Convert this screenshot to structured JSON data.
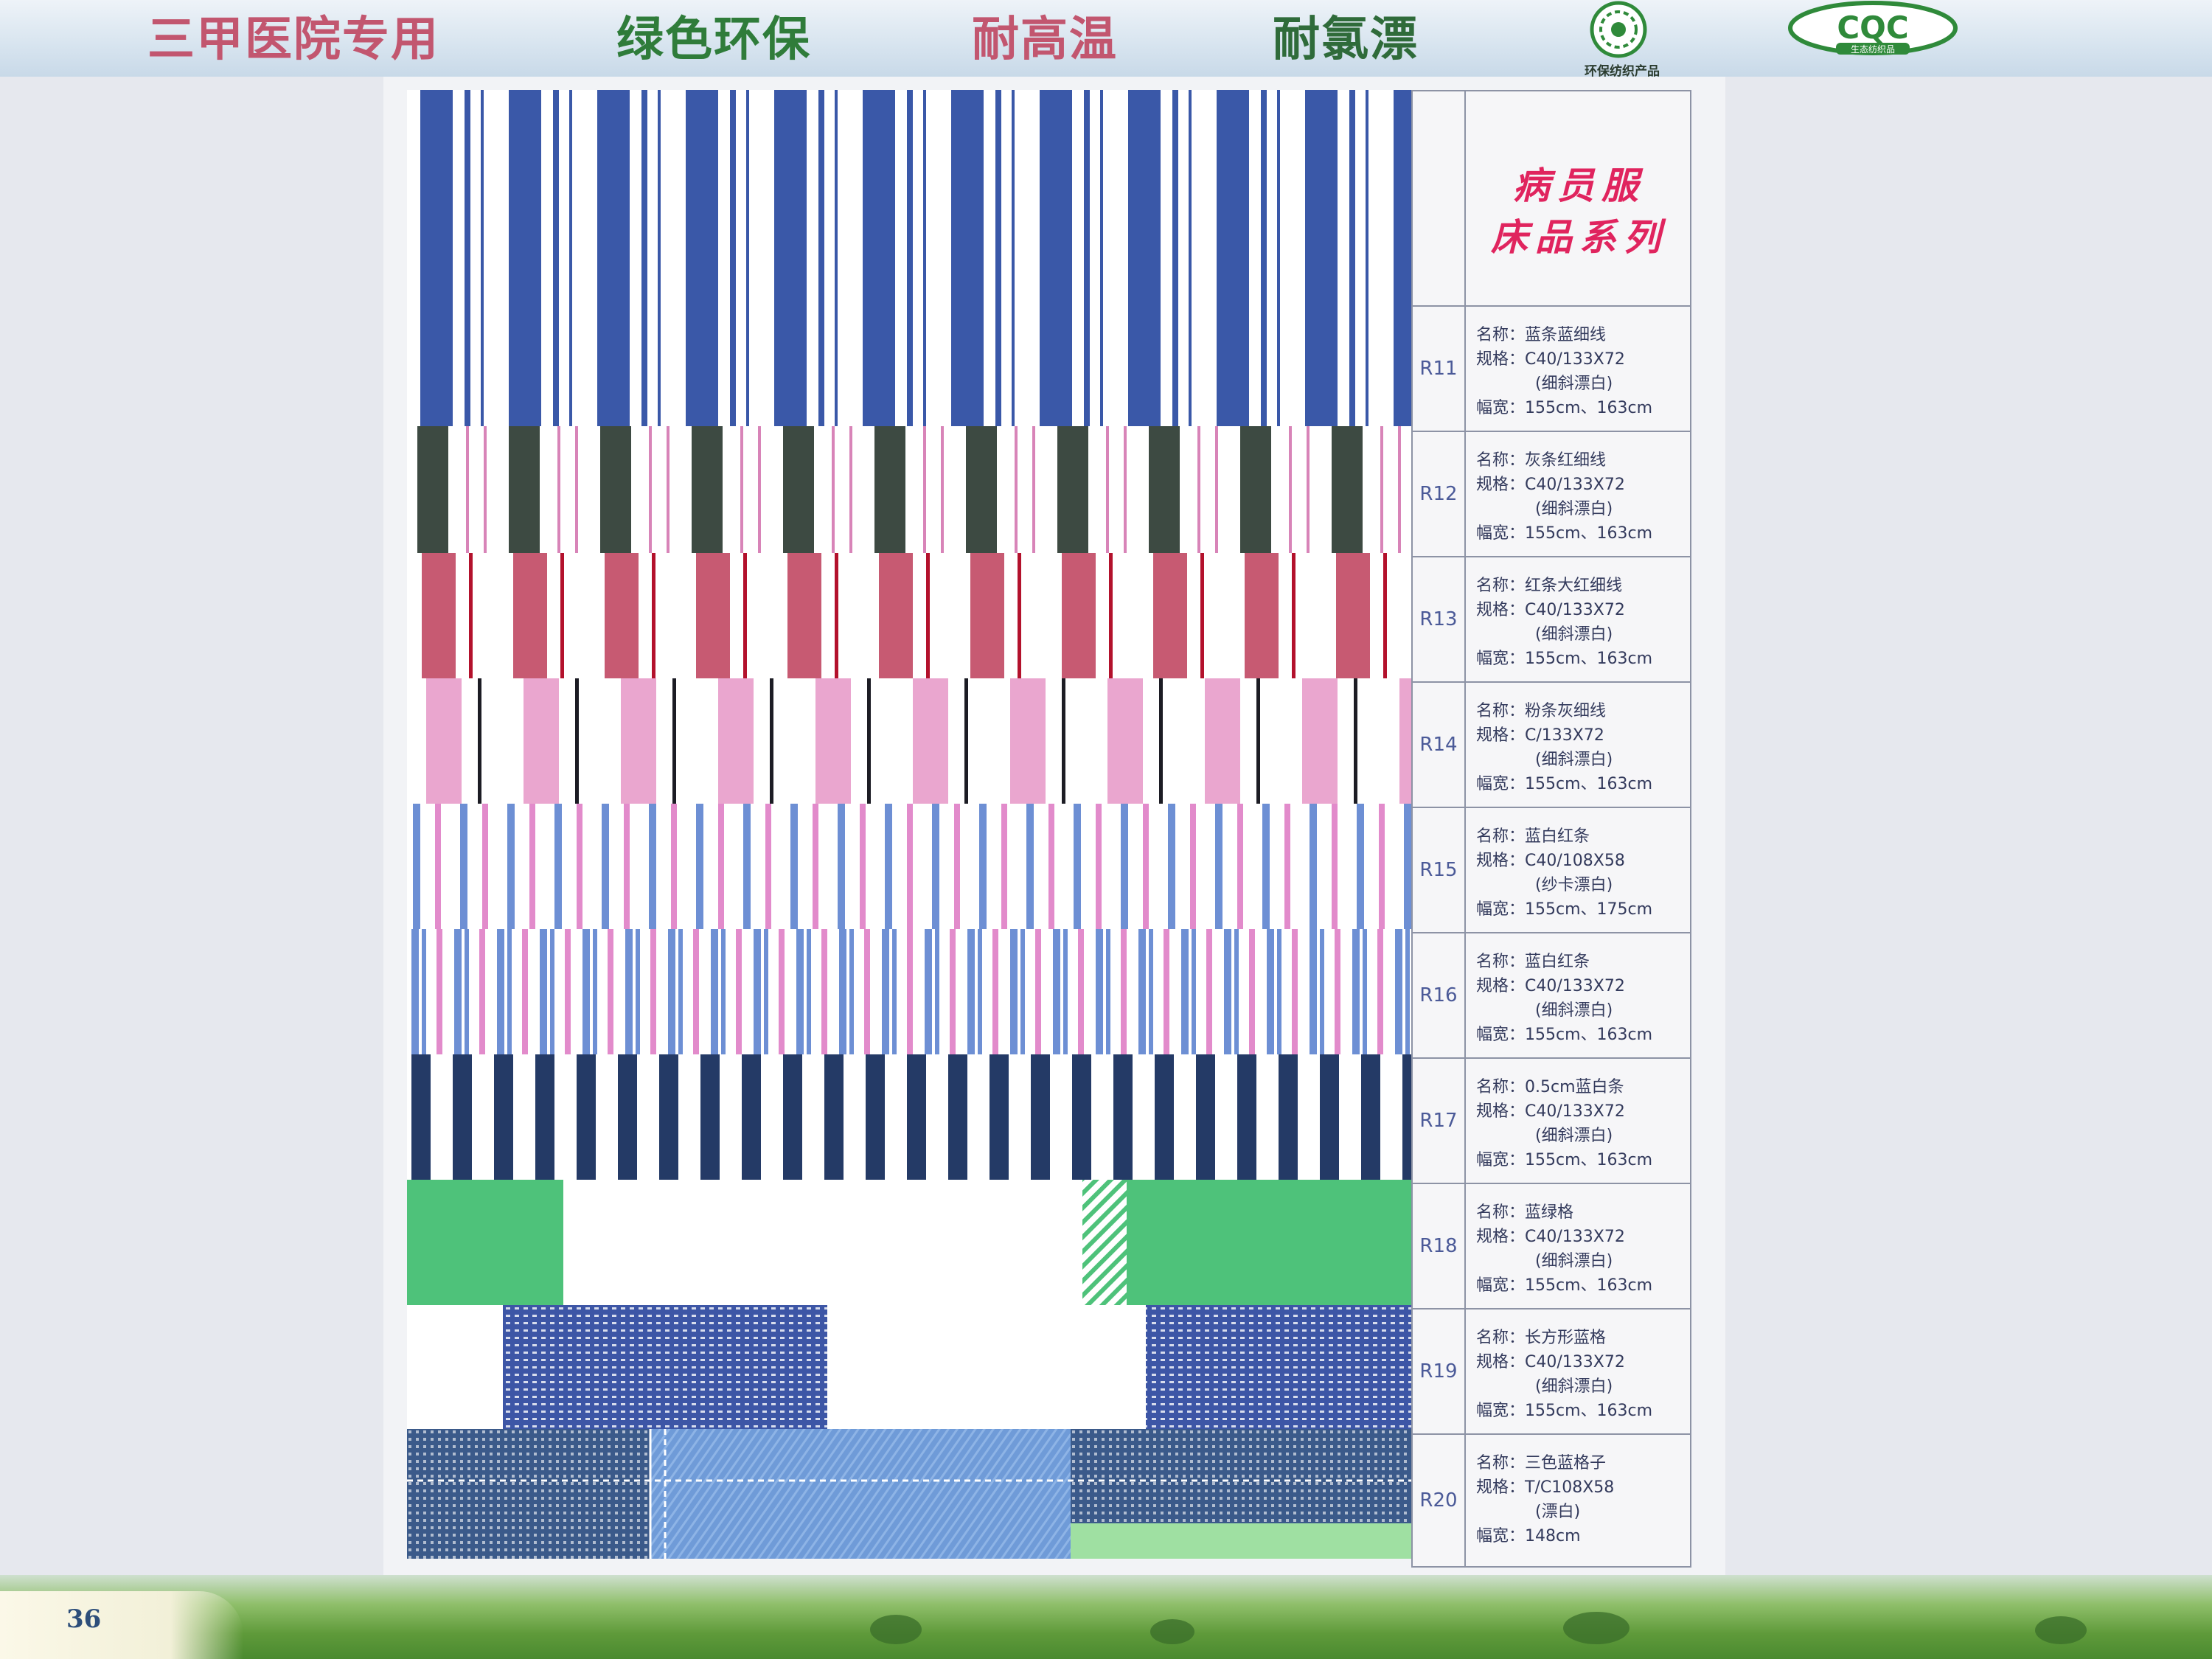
{
  "banner": {
    "slogans": [
      "三甲医院专用",
      "绿色环保",
      "耐高温",
      "耐氯漂"
    ],
    "eco_caption": "环保纺织产品",
    "cqc_text": "CQC",
    "cqc_caption": "生态纺织品"
  },
  "catalog": {
    "title_line1": "病员服",
    "title_line2": "床品系列"
  },
  "labels": {
    "name": "名称：",
    "spec": "规格：",
    "width": "幅宽："
  },
  "items": [
    {
      "code": "R11",
      "name": "蓝条蓝细线",
      "spec": "C40/133X72",
      "note": "(细斜漂白)",
      "width": "155cm、163cm"
    },
    {
      "code": "R12",
      "name": "灰条红细线",
      "spec": "C40/133X72",
      "note": "(细斜漂白)",
      "width": "155cm、163cm"
    },
    {
      "code": "R13",
      "name": "红条大红细线",
      "spec": "C40/133X72",
      "note": "(细斜漂白)",
      "width": "155cm、163cm"
    },
    {
      "code": "R14",
      "name": "粉条灰细线",
      "spec": "C/133X72",
      "note": "(细斜漂白)",
      "width": "155cm、163cm"
    },
    {
      "code": "R15",
      "name": "蓝白红条",
      "spec": "C40/108X58",
      "note": "(纱卡漂白)",
      "width": "155cm、175cm"
    },
    {
      "code": "R16",
      "name": "蓝白红条",
      "spec": "C40/133X72",
      "note": "(细斜漂白)",
      "width": "155cm、163cm"
    },
    {
      "code": "R17",
      "name": "0.5cm蓝白条",
      "spec": "C40/133X72",
      "note": "(细斜漂白)",
      "width": "155cm、163cm"
    },
    {
      "code": "R18",
      "name": "蓝绿格",
      "spec": "C40/133X72",
      "note": "(细斜漂白)",
      "width": "155cm、163cm"
    },
    {
      "code": "R19",
      "name": "长方形蓝格",
      "spec": "C40/133X72",
      "note": "(细斜漂白)",
      "width": "155cm、163cm"
    },
    {
      "code": "R20",
      "name": "三色蓝格子",
      "spec": "T/C108X58",
      "note": "(漂白)",
      "width": "148cm"
    }
  ],
  "footer": {
    "page_number": "36"
  },
  "colors": {
    "title_pink": "#e0245e",
    "code_blue": "#4b5a98",
    "r11_blue": "#3a58a8",
    "r12_gray": "#3d4a42",
    "r13_red": "#c75a72",
    "r14_pink": "#eaa6cf",
    "r15_blue": "#6d8fd4",
    "r17_navy": "#243a66",
    "r18_green": "#4ec27a",
    "r19_blue": "#3d56a6",
    "r20_blue": "#6f9bd8"
  }
}
